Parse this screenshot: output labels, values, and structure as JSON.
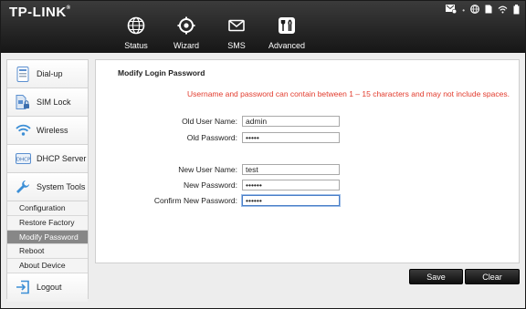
{
  "header": {
    "brand": "TP-LINK",
    "brand_mark": "®",
    "nav": [
      {
        "label": "Status",
        "icon": "globe-icon"
      },
      {
        "label": "Wizard",
        "icon": "wizard-icon"
      },
      {
        "label": "SMS",
        "icon": "envelope-icon"
      },
      {
        "label": "Advanced",
        "icon": "tools-icon"
      }
    ],
    "status_icons": [
      "sms-status-icon",
      "globe-status-icon",
      "sim-status-icon",
      "wifi-status-icon",
      "battery-icon"
    ]
  },
  "sidebar": {
    "items": [
      {
        "label": "Dial-up",
        "icon": "dialup-icon"
      },
      {
        "label": "SIM Lock",
        "icon": "sim-lock-icon"
      },
      {
        "label": "Wireless",
        "icon": "wireless-icon"
      },
      {
        "label": "DHCP Server",
        "icon": "dhcp-icon"
      },
      {
        "label": "System Tools",
        "icon": "wrench-icon"
      }
    ],
    "sub_items": [
      {
        "label": "Configuration",
        "active": false
      },
      {
        "label": "Restore Factory",
        "active": false
      },
      {
        "label": "Modify Password",
        "active": true
      },
      {
        "label": "Reboot",
        "active": false
      },
      {
        "label": "About Device",
        "active": false
      }
    ],
    "logout": {
      "label": "Logout",
      "icon": "logout-icon"
    }
  },
  "main": {
    "title": "Modify Login Password",
    "notice": "Username and password can contain between 1 – 15 characters and may not include spaces.",
    "fields": {
      "old_user": {
        "label": "Old User Name:",
        "value": "admin"
      },
      "old_pass": {
        "label": "Old Password:",
        "value": "admin"
      },
      "new_user": {
        "label": "New User Name:",
        "value": "test"
      },
      "new_pass": {
        "label": "New Password:",
        "value": "123456"
      },
      "confirm_pass": {
        "label": "Confirm New Password:",
        "value": "123456"
      }
    }
  },
  "buttons": {
    "save": "Save",
    "clear": "Clear"
  },
  "colors": {
    "accent": "#878787",
    "notice": "#e23b2d",
    "header": "#262626"
  }
}
